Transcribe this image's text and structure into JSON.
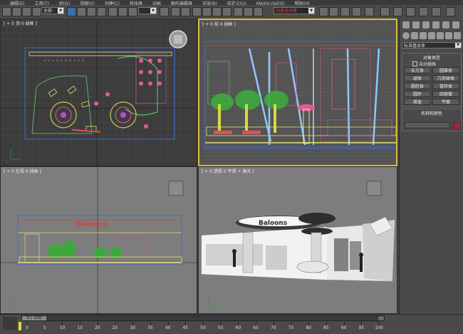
{
  "menu": [
    "编辑(E)",
    "工具(T)",
    "组(G)",
    "视图(V)",
    "创建(C)",
    "修改器",
    "动画",
    "图形编辑器",
    "渲染(R)",
    "自定义(U)",
    "MAXScript(X)",
    "帮助(H)"
  ],
  "toolbar": {
    "selection_filter": "全部",
    "named_selection": "创建选择集"
  },
  "viewports": {
    "top_label": "[ + 0 顶 0 线框 ]",
    "front_label": "[ + 0 前 0 线框 ]",
    "left_label": "[ + 0 左视 0 线框 ]",
    "persp_label": "[ + 0 透视 0 平滑 + 高光 ]",
    "sign_text": "Baloons"
  },
  "command_panel": {
    "dropdown": "标准基本体",
    "object_type_header": "对象类型",
    "autogrid": "自动栅格",
    "buttons": [
      "长方体",
      "圆锥体",
      "球体",
      "几何球体",
      "圆柱体",
      "管状体",
      "圆环",
      "四棱锥",
      "茶壶",
      "平面"
    ],
    "name_color_header": "名称和颜色",
    "name_value": ""
  },
  "timeline": {
    "frame_display": "0 / 100",
    "ticks": [
      "0",
      "5",
      "10",
      "15",
      "20",
      "25",
      "30",
      "35",
      "40",
      "45",
      "50",
      "55",
      "60",
      "65",
      "70",
      "75",
      "80",
      "85",
      "90",
      "95",
      "100"
    ]
  }
}
